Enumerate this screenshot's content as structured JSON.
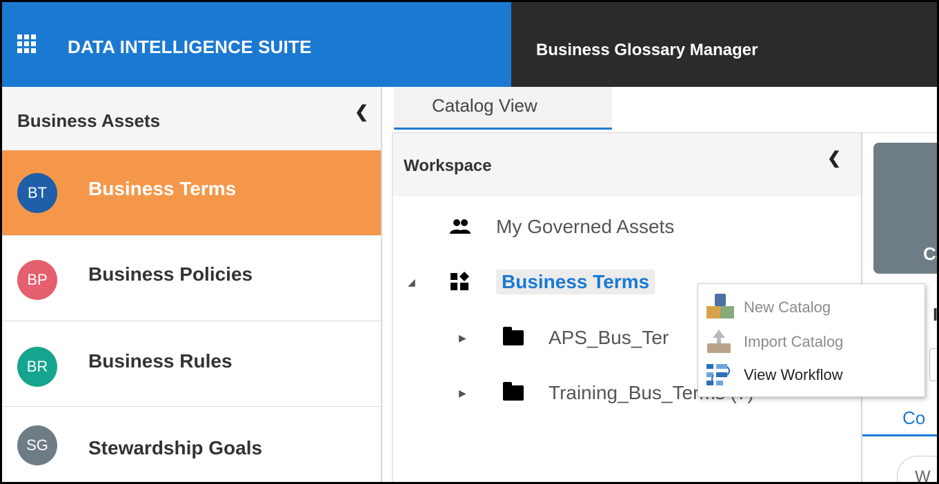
{
  "header": {
    "brand_title": "DATA INTELLIGENCE SUITE",
    "app_title": "Business Glossary Manager",
    "colors": {
      "brand_bg": "#1b79d2",
      "app_bg": "#2b2b2b"
    },
    "icons": {
      "apps": "grid-apps-icon"
    }
  },
  "sidebar": {
    "title": "Business Assets",
    "collapse_icon": "chevron-left-icon",
    "items": [
      {
        "initials": "BT",
        "label": "Business Terms",
        "avatar_color": "#1f5ea8",
        "active": true
      },
      {
        "initials": "BP",
        "label": "Business Policies",
        "avatar_color": "#e65f6e",
        "active": false
      },
      {
        "initials": "BR",
        "label": "Business Rules",
        "avatar_color": "#15a48e",
        "active": false
      },
      {
        "initials": "SG",
        "label": "Stewardship Goals",
        "avatar_color": "#6e7c86",
        "active": false
      }
    ],
    "active_color": "#f5974a"
  },
  "main": {
    "tab": {
      "label": "Catalog View"
    },
    "workspace": {
      "title": "Workspace",
      "collapse_icon": "chevron-left-icon",
      "tree": [
        {
          "label": "My Governed Assets",
          "icon": "people-icon"
        },
        {
          "label": "Business Terms",
          "icon": "catalog-icon",
          "selected": true,
          "expanded": true
        },
        {
          "label": "APS_Bus_Ter",
          "icon": "folder-icon",
          "expanded": false
        },
        {
          "label": "Training_Bus_Terms (7)",
          "icon": "folder-icon",
          "expanded": false
        }
      ]
    },
    "right_panel": {
      "card_text": "Cat",
      "heading_partial": "IN",
      "tab_partial": "Co",
      "pill_partial": "W"
    }
  },
  "context_menu": {
    "items": [
      {
        "label": "New Catalog",
        "icon": "new-catalog-icon",
        "disabled": true
      },
      {
        "label": "Import Catalog",
        "icon": "import-catalog-icon",
        "disabled": true
      },
      {
        "label": "View Workflow",
        "icon": "workflow-icon",
        "disabled": false
      }
    ]
  }
}
